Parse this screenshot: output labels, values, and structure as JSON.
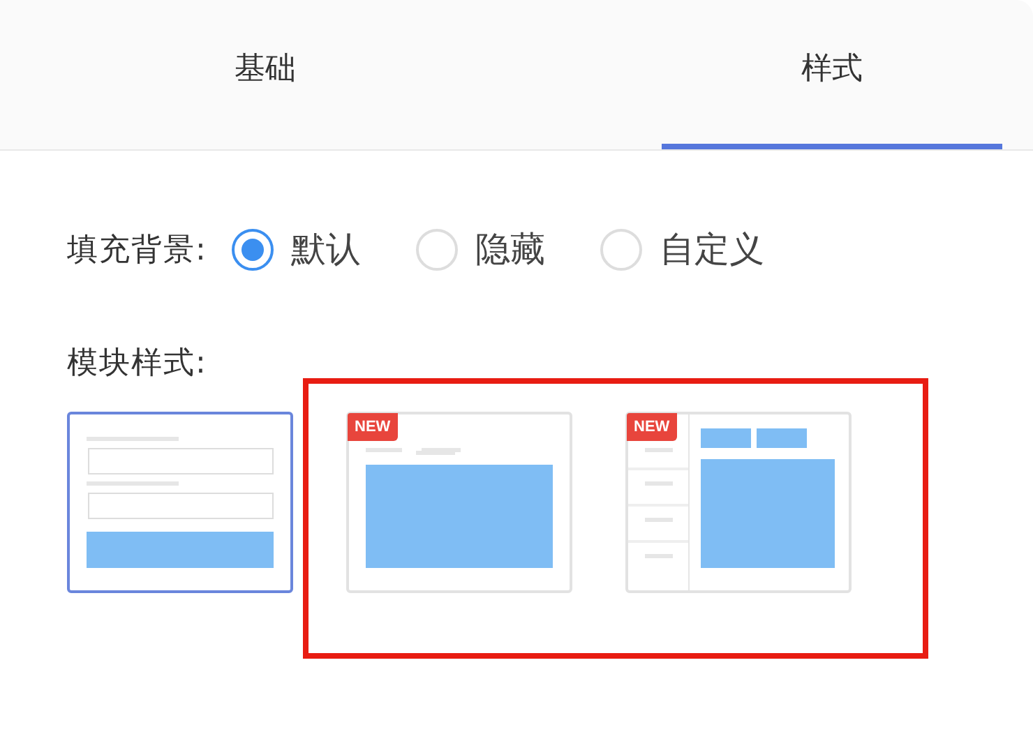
{
  "tabs": [
    {
      "label": "基础",
      "selected": false
    },
    {
      "label": "样式",
      "selected": true
    }
  ],
  "background_fill": {
    "label": "填充背景:",
    "options": [
      {
        "label": "默认",
        "selected": true
      },
      {
        "label": "隐藏",
        "selected": false
      },
      {
        "label": "自定义",
        "selected": false
      }
    ]
  },
  "module_style": {
    "label": "模块样式:",
    "options": [
      {
        "kind": "form",
        "selected": true
      },
      {
        "kind": "tabs",
        "selected": false,
        "badge": "NEW"
      },
      {
        "kind": "sidebar",
        "selected": false,
        "badge": "NEW"
      }
    ]
  }
}
